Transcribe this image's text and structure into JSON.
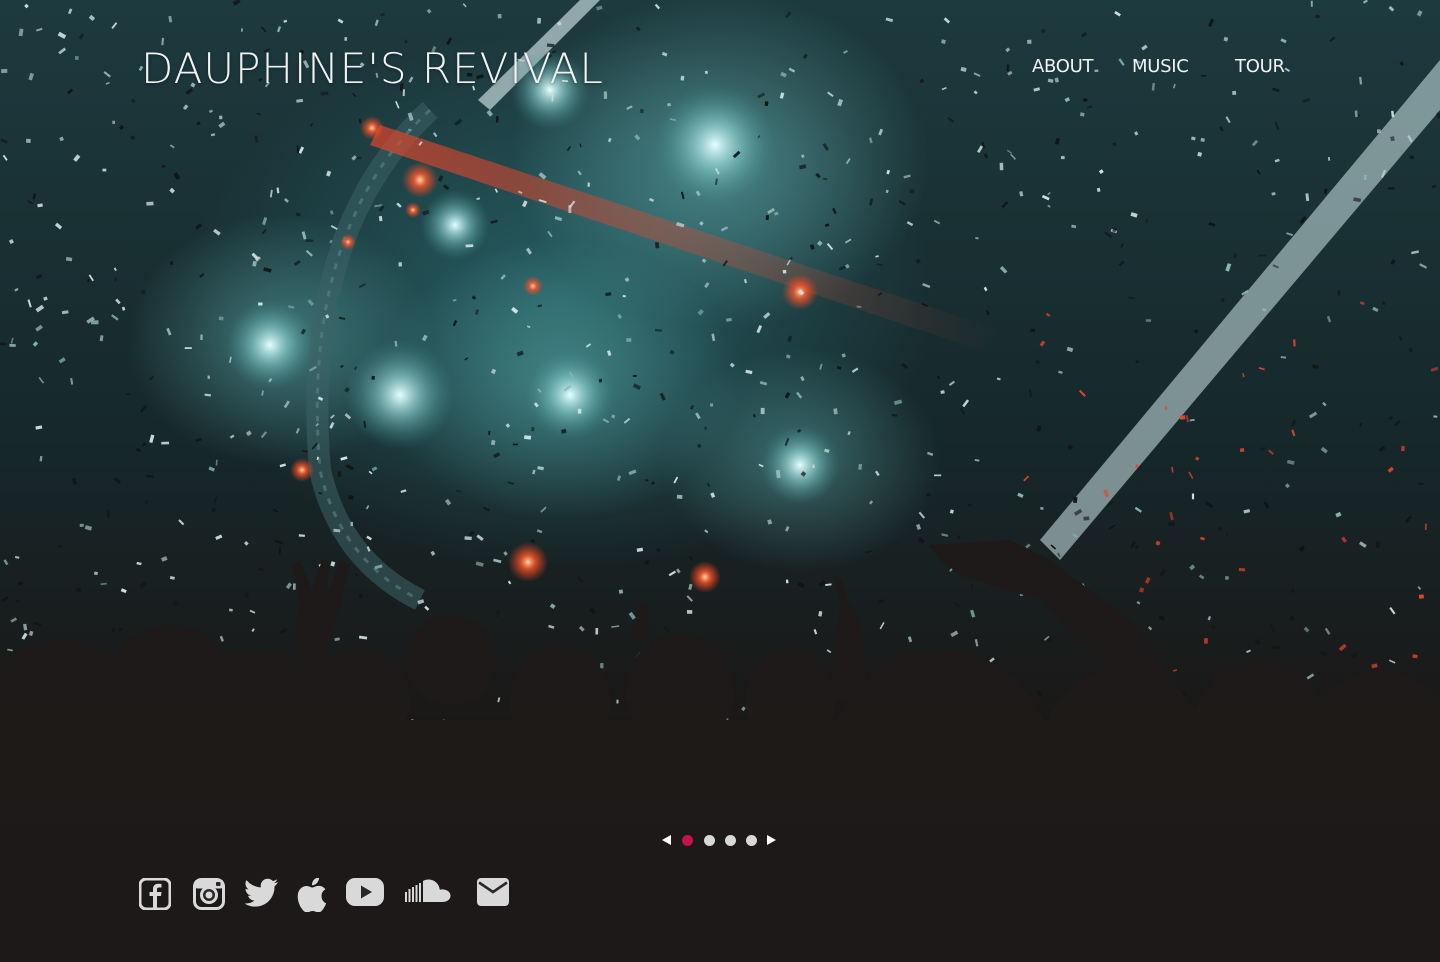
{
  "site": {
    "title": "DAUPHINE'S REVIVAL"
  },
  "nav": {
    "items": [
      {
        "label": "ABOUT"
      },
      {
        "label": "MUSIC"
      },
      {
        "label": "TOUR"
      }
    ]
  },
  "slider": {
    "slide_count": 4,
    "active_index": 1,
    "active_color": "#c4124f",
    "dot_color": "#d8d8d8",
    "prev_icon": "triangle-left-icon",
    "next_icon": "triangle-right-icon"
  },
  "social": {
    "icon_color": "#d9d9d9",
    "items": [
      {
        "icon": "facebook-icon"
      },
      {
        "icon": "instagram-icon"
      },
      {
        "icon": "twitter-icon"
      },
      {
        "icon": "apple-icon"
      },
      {
        "icon": "youtube-icon"
      },
      {
        "icon": "soundcloud-icon"
      },
      {
        "icon": "email-icon"
      }
    ]
  },
  "hero": {
    "image": "concert-crowd-confetti-photo",
    "colors": {
      "teal_light": "#7ec8c8",
      "stage_red": "#e8452a",
      "crowd_dark": "#1c1817"
    }
  }
}
